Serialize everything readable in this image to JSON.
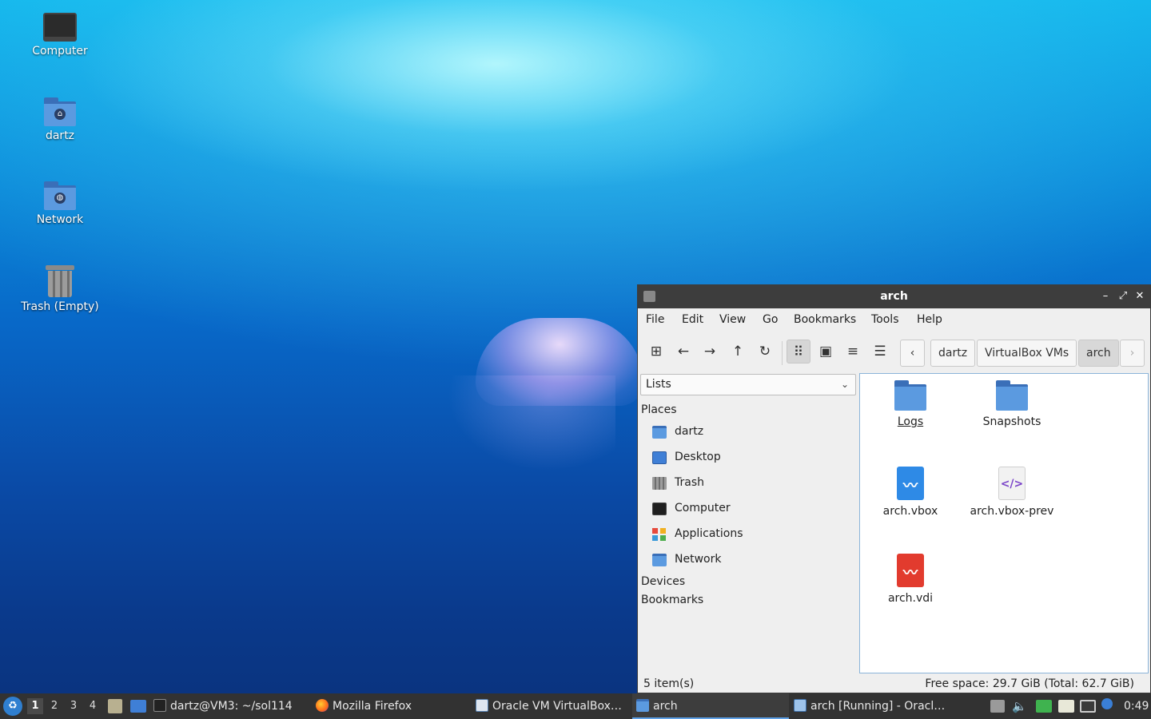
{
  "desktop": {
    "icons": [
      {
        "label": "Computer",
        "icon": "monitor-icon"
      },
      {
        "label": "dartz",
        "icon": "home-folder-icon"
      },
      {
        "label": "Network",
        "icon": "network-folder-icon"
      },
      {
        "label": "Trash (Empty)",
        "icon": "trash-icon"
      }
    ]
  },
  "window": {
    "title": "arch",
    "controls": {
      "minimize": "–",
      "maximize": "⤢",
      "close": "✕"
    },
    "menu": [
      "File",
      "Edit",
      "View",
      "Go",
      "Bookmarks",
      "Tools",
      "Help"
    ],
    "toolbar": {
      "buttons": [
        "new-tab-icon",
        "back-icon",
        "forward-icon",
        "up-icon",
        "reload-icon",
        "icon-view-icon",
        "thumbnail-view-icon",
        "compact-view-icon",
        "detailed-list-view-icon"
      ],
      "breadcrumb": [
        "dartz",
        "VirtualBox VMs",
        "arch"
      ]
    },
    "sidebar": {
      "combo_value": "Lists",
      "places_header": "Places",
      "places": [
        {
          "label": "dartz",
          "icon": "home-folder-icon"
        },
        {
          "label": "Desktop",
          "icon": "desktop-icon"
        },
        {
          "label": "Trash",
          "icon": "trash-icon"
        },
        {
          "label": "Computer",
          "icon": "monitor-icon"
        },
        {
          "label": "Applications",
          "icon": "applications-icon"
        },
        {
          "label": "Network",
          "icon": "network-folder-icon"
        }
      ],
      "devices_header": "Devices",
      "bookmarks_header": "Bookmarks"
    },
    "files": [
      {
        "name": "Logs",
        "kind": "folder"
      },
      {
        "name": "Snapshots",
        "kind": "folder"
      },
      {
        "name": "arch.vbox",
        "kind": "vbox-file"
      },
      {
        "name": "arch.vbox-prev",
        "kind": "xml-file"
      },
      {
        "name": "arch.vdi",
        "kind": "vdi-file"
      }
    ],
    "status": {
      "items": "5 item(s)",
      "free_space": "Free space: 29.7 GiB (Total: 62.7 GiB)"
    }
  },
  "taskbar": {
    "workspaces": [
      "1",
      "2",
      "3",
      "4"
    ],
    "active_workspace": "1",
    "tasks": [
      {
        "label": "dartz@VM3: ~/sol114",
        "icon": "terminal-icon"
      },
      {
        "label": "Mozilla Firefox",
        "icon": "firefox-icon"
      },
      {
        "label": "Oracle VM VirtualBox…",
        "icon": "virtualbox-icon"
      },
      {
        "label": "arch",
        "icon": "folder-icon"
      },
      {
        "label": "arch [Running] - Oracl…",
        "icon": "vm-running-icon"
      }
    ],
    "clock": "0:49"
  }
}
